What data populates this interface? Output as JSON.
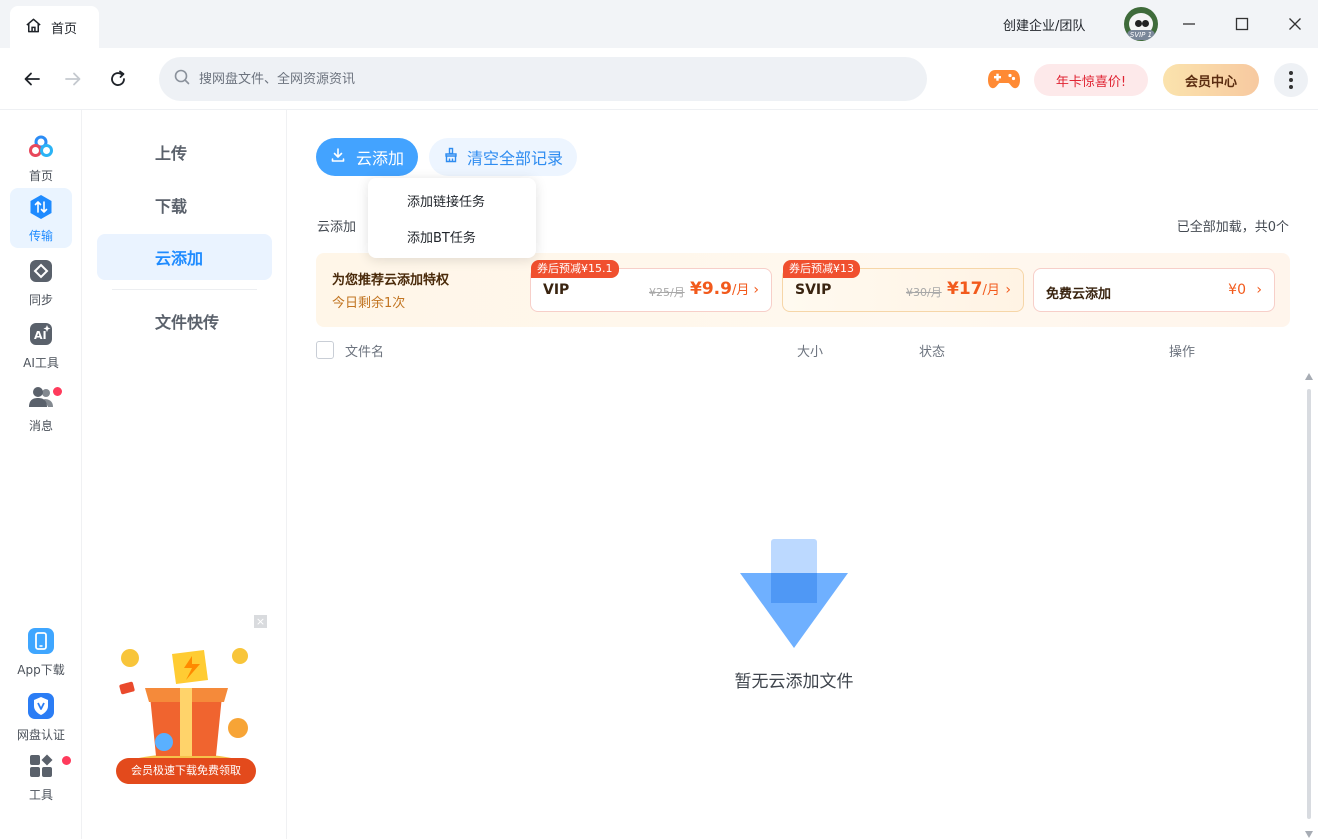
{
  "window": {
    "tab_label": "首页",
    "team_label": "创建企业/团队",
    "avatar_badge": "SVIP 1"
  },
  "toolbar": {
    "search_placeholder": "搜网盘文件、全网资源资讯",
    "promo_label": "年卡惊喜价!",
    "vip_center_label": "会员中心"
  },
  "rail": {
    "items": [
      {
        "label": "首页",
        "icon": "home-icon"
      },
      {
        "label": "传输",
        "icon": "transfer-icon",
        "active": true
      },
      {
        "label": "同步",
        "icon": "sync-icon"
      },
      {
        "label": "AI工具",
        "icon": "ai-tools-icon"
      },
      {
        "label": "消息",
        "icon": "message-icon",
        "badge": true
      }
    ],
    "bottom_items": [
      {
        "label": "App下载",
        "icon": "phone-icon"
      },
      {
        "label": "网盘认证",
        "icon": "verify-icon"
      },
      {
        "label": "工具",
        "icon": "tools-icon",
        "badge": true
      }
    ]
  },
  "subnav": {
    "items": [
      {
        "label": "上传"
      },
      {
        "label": "下载"
      },
      {
        "label": "云添加",
        "active": true
      },
      {
        "label": "文件快传"
      }
    ],
    "ad_close": "×",
    "ad_banner": "会员极速下载免费领取"
  },
  "main": {
    "add_button": "云添加",
    "clear_button": "清空全部记录",
    "dropdown": [
      "添加链接任务",
      "添加BT任务"
    ],
    "section_label": "云添加",
    "count_text": "已全部加载，共0个",
    "promo": {
      "title": "为您推荐云添加特权",
      "subtitle": "今日剩余1次",
      "plans": [
        {
          "badge": "券后预减¥15.1",
          "name": "VIP",
          "old_price": "¥25/月",
          "price": "¥9.9",
          "unit": "/月",
          "arrow": "›"
        },
        {
          "badge": "券后预减¥13",
          "name": "SVIP",
          "old_price": "¥30/月",
          "price": "¥17",
          "unit": "/月",
          "arrow": "›"
        }
      ],
      "free": {
        "name": "免费云添加",
        "price": "¥0",
        "arrow": "›"
      }
    },
    "columns": [
      "文件名",
      "大小",
      "状态",
      "操作"
    ],
    "empty_text": "暂无云添加文件"
  },
  "colors": {
    "accent": "#43a3ff",
    "active_bg": "#eaf3ff",
    "promo_price": "#f25a1c",
    "badge_red": "#ff3b5c"
  }
}
